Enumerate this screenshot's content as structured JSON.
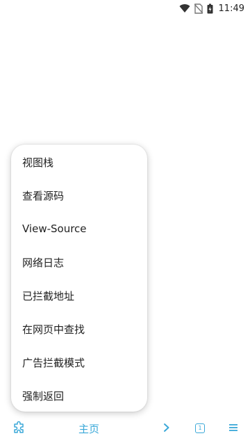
{
  "status_bar": {
    "time": "11:49",
    "icons": [
      "wifi-icon",
      "no-sim-icon",
      "battery-charging-icon"
    ]
  },
  "menu": {
    "items": [
      {
        "label": "视图栈"
      },
      {
        "label": "查看源码"
      },
      {
        "label": "View-Source"
      },
      {
        "label": "网络日志"
      },
      {
        "label": "已拦截地址"
      },
      {
        "label": "在网页中查找"
      },
      {
        "label": "广告拦截模式"
      },
      {
        "label": "强制返回"
      }
    ]
  },
  "toolbar": {
    "home_label": "主页",
    "tab_count": "1",
    "accent_color": "#3aa8d8",
    "icons": [
      "puzzle-icon",
      "chevron-right-icon",
      "tabs-icon",
      "menu-icon"
    ]
  }
}
